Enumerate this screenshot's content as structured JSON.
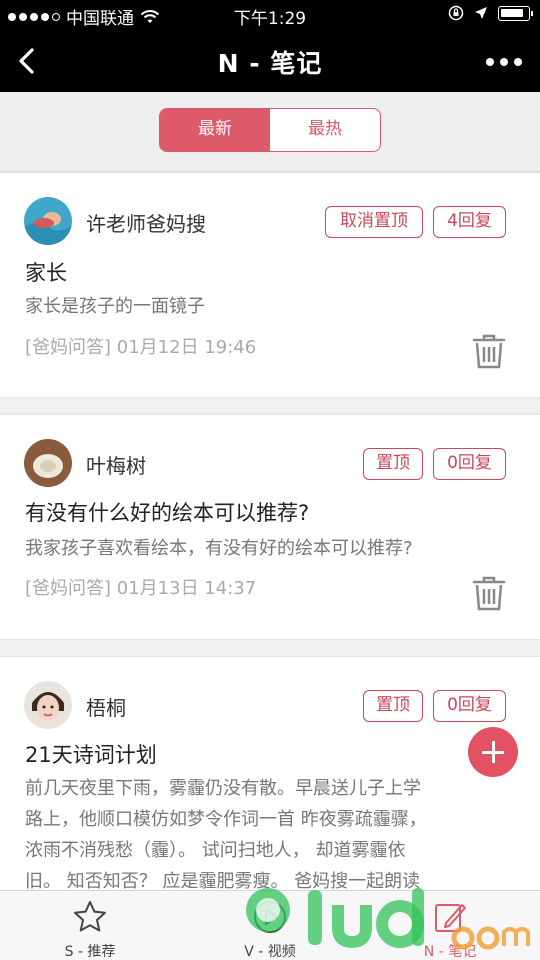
{
  "status_bar": {
    "carrier": "中国联通",
    "time": "下午1:29"
  },
  "nav": {
    "title": "N - 笔记",
    "back_icon": "chevron-left-icon",
    "more_icon": "more-dots-icon"
  },
  "segment": {
    "tabs": [
      {
        "label": "最新",
        "active": true
      },
      {
        "label": "最热",
        "active": false
      }
    ]
  },
  "posts": [
    {
      "author": "许老师爸妈搜",
      "pin_label": "取消置顶",
      "reply_label": "4回复",
      "title": "家长",
      "body": "家长是孩子的一面镜子",
      "meta": "[爸妈问答] 01月12日 19:46"
    },
    {
      "author": "叶梅树",
      "pin_label": "置顶",
      "reply_label": "0回复",
      "title": "有没有什么好的绘本可以推荐?",
      "body": "我家孩子喜欢看绘本，有没有好的绘本可以推荐?",
      "meta": "[爸妈问答] 01月13日 14:37"
    },
    {
      "author": "梧桐",
      "pin_label": "置顶",
      "reply_label": "0回复",
      "title": "21天诗词计划",
      "body_lines": [
        "前几天夜里下雨，雾霾仍没有散。早晨送儿子上学",
        "路上，他顺口模仿如梦令作词一首 昨夜雾疏霾骤，",
        "浓雨不消残愁（霾）。 试问扫地人， 却道雾霾依",
        "旧。 知否知否？ 应是霾肥雾瘦。 爸妈搜一起朗读"
      ]
    }
  ],
  "tab_bar": {
    "items": [
      {
        "label": "S - 推荐",
        "icon": "star-icon"
      },
      {
        "label": "V - 视频",
        "icon": "play-circle-icon"
      },
      {
        "label": "N - 笔记",
        "icon": "edit-note-icon"
      }
    ]
  },
  "colors": {
    "accent": "#dd5a6a",
    "nav_bg": "#000000",
    "page_bg": "#f0f0f0"
  }
}
